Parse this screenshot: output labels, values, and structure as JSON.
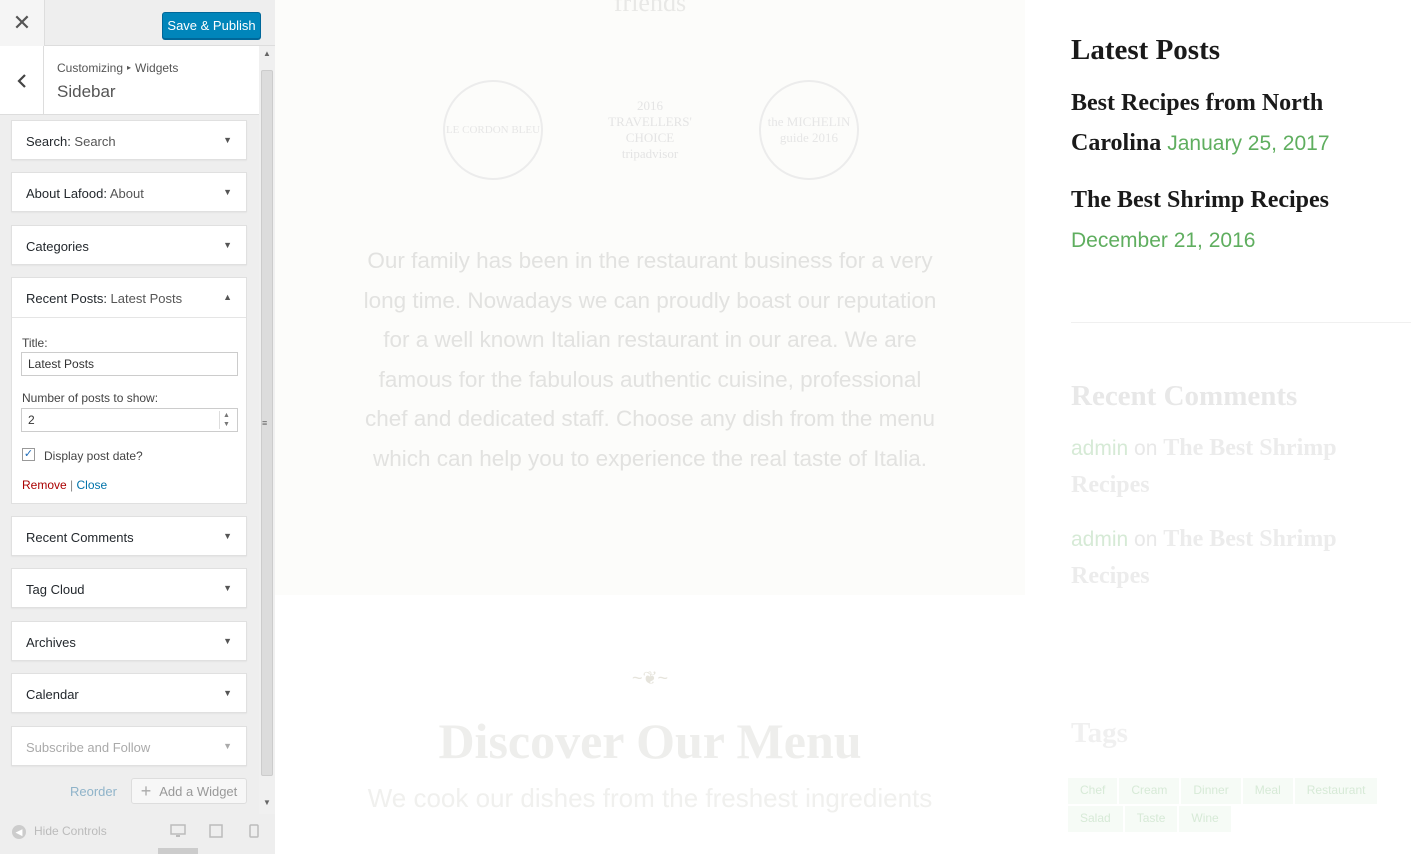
{
  "toolbar": {
    "close_icon": "close-icon",
    "save_label": "Save & Publish"
  },
  "header": {
    "crumb_root": "Customizing",
    "crumb_sep": "▸",
    "crumb_section": "Widgets",
    "title": "Sidebar"
  },
  "widgets": [
    {
      "name": "Search:",
      "sub": " Search"
    },
    {
      "name": "About Lafood:",
      "sub": " About"
    },
    {
      "name": "Categories",
      "sub": ""
    },
    {
      "name": "Recent Posts:",
      "sub": " Latest Posts"
    },
    {
      "name": "Recent Comments",
      "sub": ""
    },
    {
      "name": "Tag Cloud",
      "sub": ""
    },
    {
      "name": "Archives",
      "sub": ""
    },
    {
      "name": "Calendar",
      "sub": ""
    },
    {
      "name": "Subscribe and Follow",
      "sub": ""
    }
  ],
  "form": {
    "title_label": "Title:",
    "title_value": "Latest Posts",
    "count_label": "Number of posts to show:",
    "count_value": "2",
    "date_label": "Display post date?",
    "date_checked": true,
    "remove": "Remove",
    "sep": " | ",
    "close": "Close"
  },
  "actions": {
    "reorder": "Reorder",
    "add_widget": "Add a Widget"
  },
  "footer": {
    "hide_controls": "Hide Controls"
  },
  "preview": {
    "friends": "friends",
    "badges": [
      {
        "text": "LE CORDON BLEU"
      },
      {
        "text": "2016 TRAVELLERS' CHOICE tripadvisor"
      },
      {
        "text": "the MICHELIN guide 2016"
      }
    ],
    "story": "Our family has been in the restaurant business for a very long time. Nowadays we can proudly boast our reputation for a well known Italian restaurant in our area. We are famous for the fabulous authentic cuisine, professional chef and dedicated staff. Choose any dish from the menu which can help you to experience the real taste of Italia.",
    "menu_title": "Discover Our Menu",
    "menu_sub": "We cook our dishes from the freshest ingredients"
  },
  "sidebar": {
    "latest_title": "Latest Posts",
    "posts": [
      {
        "title": "Best Recipes from North Carolina",
        "date": "January 25, 2017"
      },
      {
        "title": "The Best Shrimp Recipes",
        "date": "December 21, 2016"
      }
    ],
    "comments_title": "Recent Comments",
    "comments": [
      {
        "author": "admin",
        "on": " on ",
        "post": "The Best Shrimp Recipes"
      },
      {
        "author": "admin",
        "on": " on ",
        "post": "The Best Shrimp Recipes"
      }
    ],
    "tags_title": "Tags",
    "tags": [
      "Chef",
      "Cream",
      "Dinner",
      "Meal",
      "Restaurant",
      "Salad",
      "Taste",
      "Wine"
    ]
  }
}
